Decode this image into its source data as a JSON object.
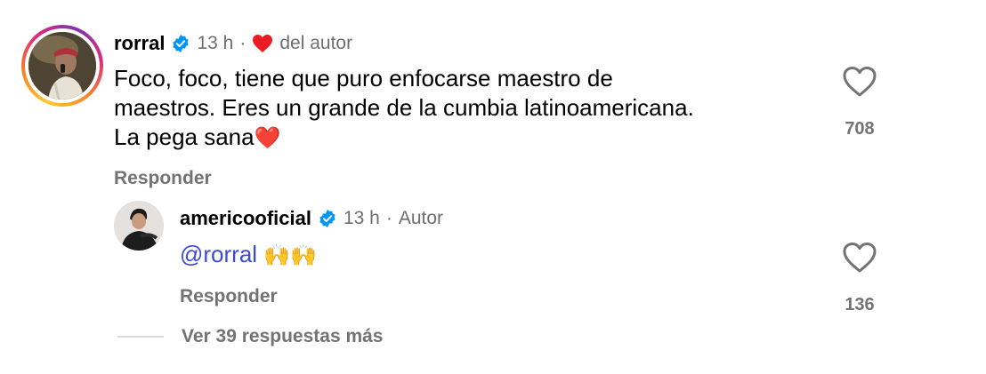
{
  "comment": {
    "username": "rorral",
    "time": "13 h",
    "separator": "·",
    "liked_by_author": "del autor",
    "text_line1": "Foco, foco, tiene que puro enfocarse maestro de",
    "text_line2": "maestros. Eres un grande de la cumbia latinoamericana.",
    "text_line3": "La pega sana",
    "text_emoji": "❤️",
    "reply_label": "Responder",
    "like_count": "708",
    "verified": true,
    "heart_color": "#ed1c24"
  },
  "reply": {
    "username": "americooficial",
    "time": "13 h",
    "separator": "·",
    "author_label": "Autor",
    "mention": "@rorral",
    "emojis": "🙌🙌",
    "reply_label": "Responder",
    "like_count": "136",
    "verified": true
  },
  "view_more": {
    "label": "Ver 39 respuestas más"
  },
  "colors": {
    "verified_badge": "#0095f6",
    "mention": "#3b4bd8",
    "secondary_text": "#737373"
  }
}
